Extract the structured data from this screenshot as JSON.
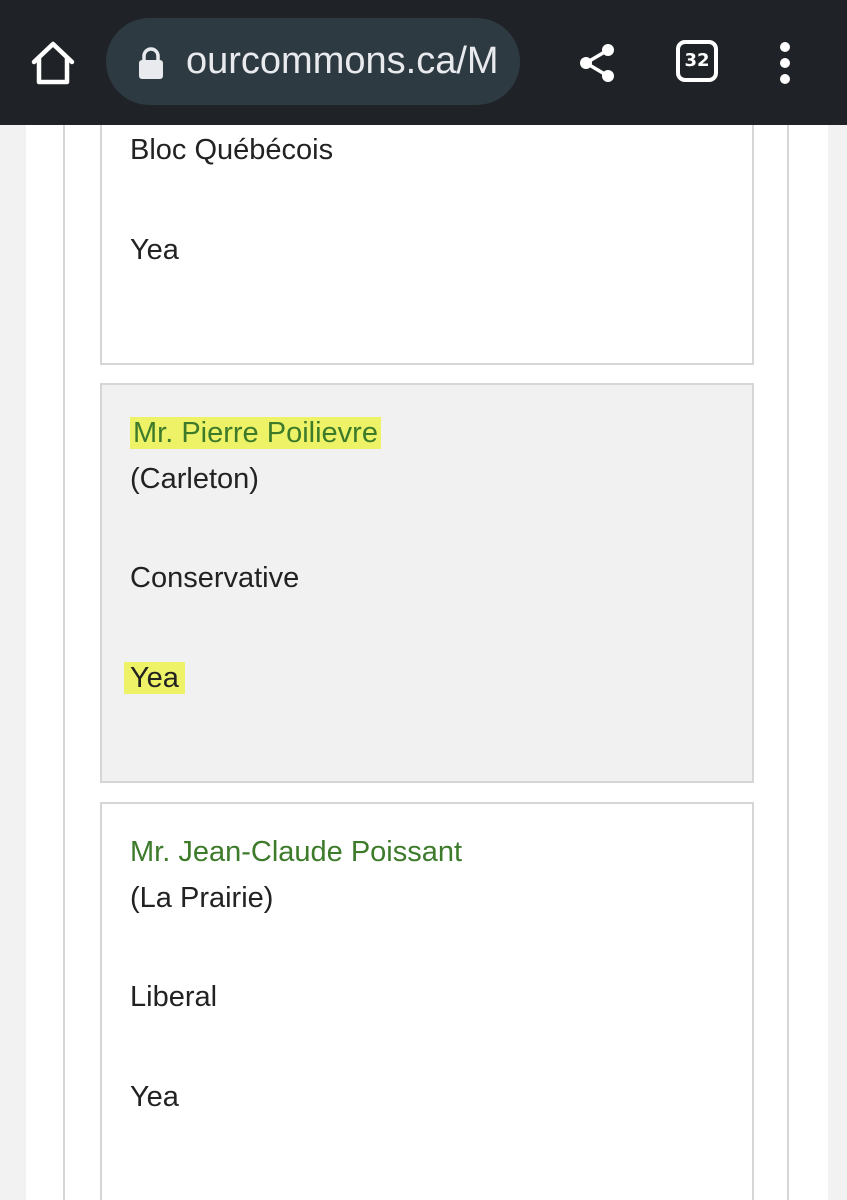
{
  "browser": {
    "url": "ourcommons.ca/M",
    "tab_count": "32",
    "icons": {
      "home": "home-icon",
      "lock": "lock-icon",
      "share": "share-icon",
      "tabs": "tab-switcher-icon",
      "menu": "more-vert-icon"
    }
  },
  "colors": {
    "toolbar": "#1f2327",
    "url_pill": "#2e3a42",
    "link_green": "#3d7b2b",
    "highlight": "#eef266",
    "shaded_card": "#f1f1f1"
  },
  "members": [
    {
      "party": "Bloc Québécois",
      "vote": "Yea"
    },
    {
      "name": "Mr. Pierre Poilievre",
      "riding": "(Carleton)",
      "party": "Conservative",
      "vote": "Yea"
    },
    {
      "name": "Mr. Jean-Claude Poissant",
      "riding": "(La Prairie)",
      "party": "Liberal",
      "vote": "Yea"
    }
  ]
}
